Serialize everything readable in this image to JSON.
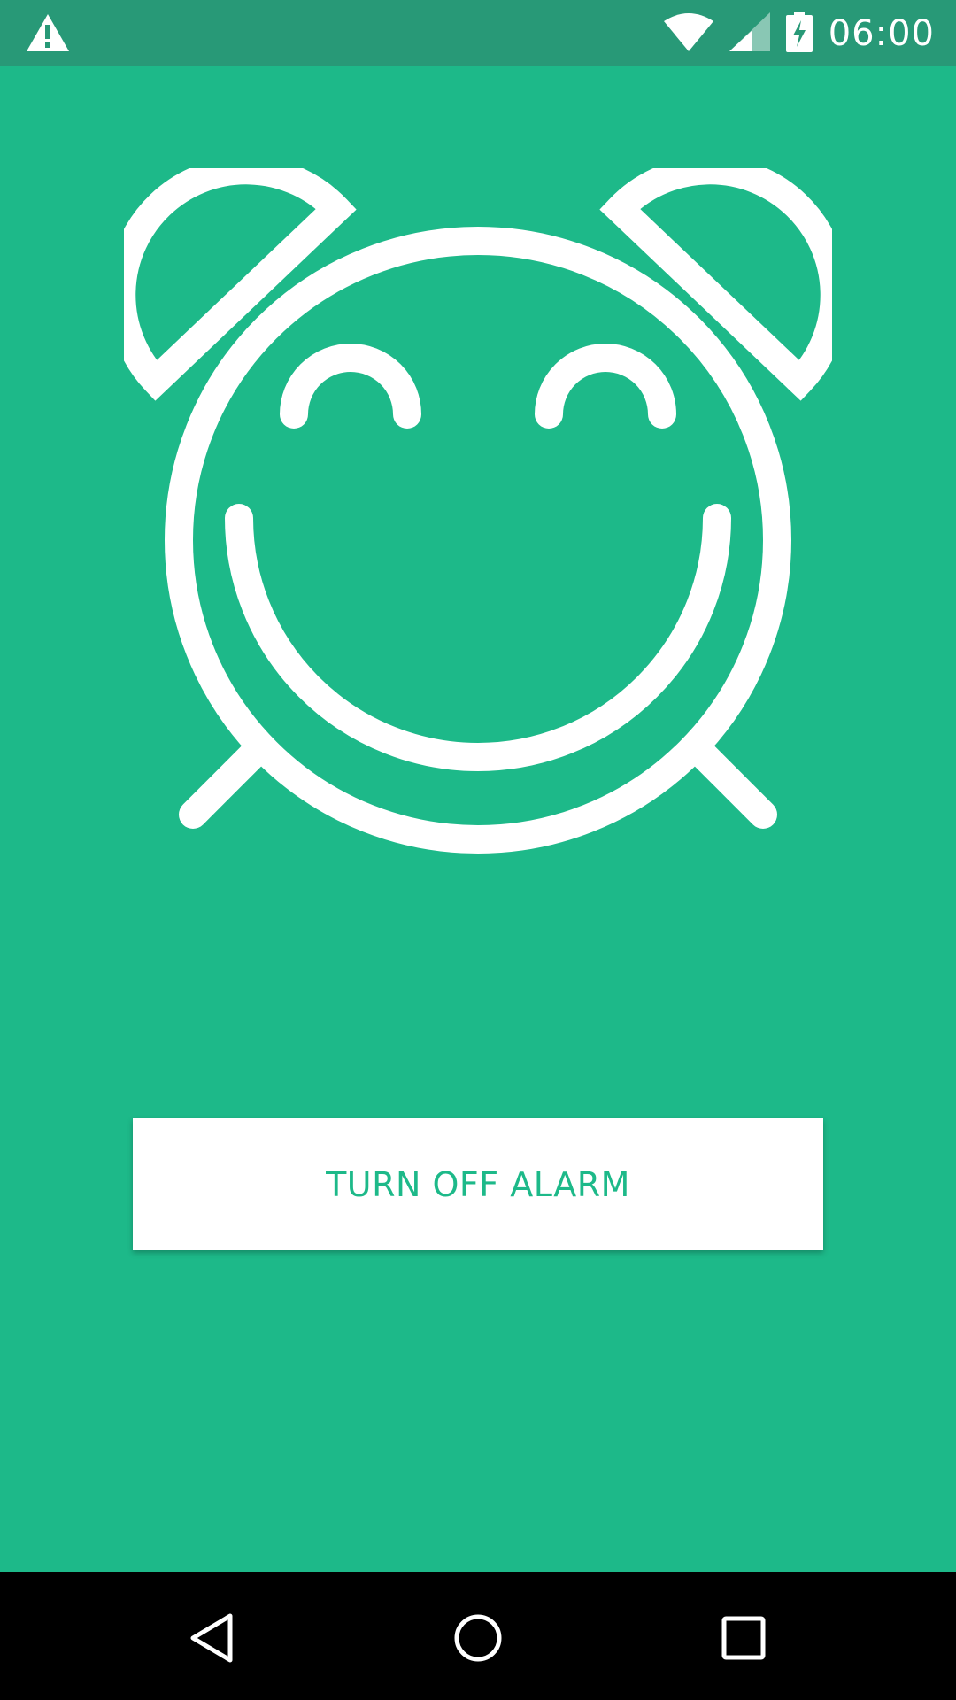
{
  "status_bar": {
    "time": "06:00",
    "icons": {
      "left": "warning-icon",
      "wifi": "wifi-icon",
      "signal": "cell-signal-icon",
      "battery": "battery-charging-icon"
    }
  },
  "main": {
    "illustration": "smiling-alarm-clock-icon",
    "button_label": "TURN OFF ALARM"
  },
  "nav_bar": {
    "icons": [
      "back-icon",
      "home-icon",
      "recents-icon"
    ]
  },
  "colors": {
    "background": "#1DB989",
    "status_bar": "#289977",
    "button_bg": "#FFFFFF",
    "button_text": "#1DB989",
    "nav_bar": "#000000"
  }
}
